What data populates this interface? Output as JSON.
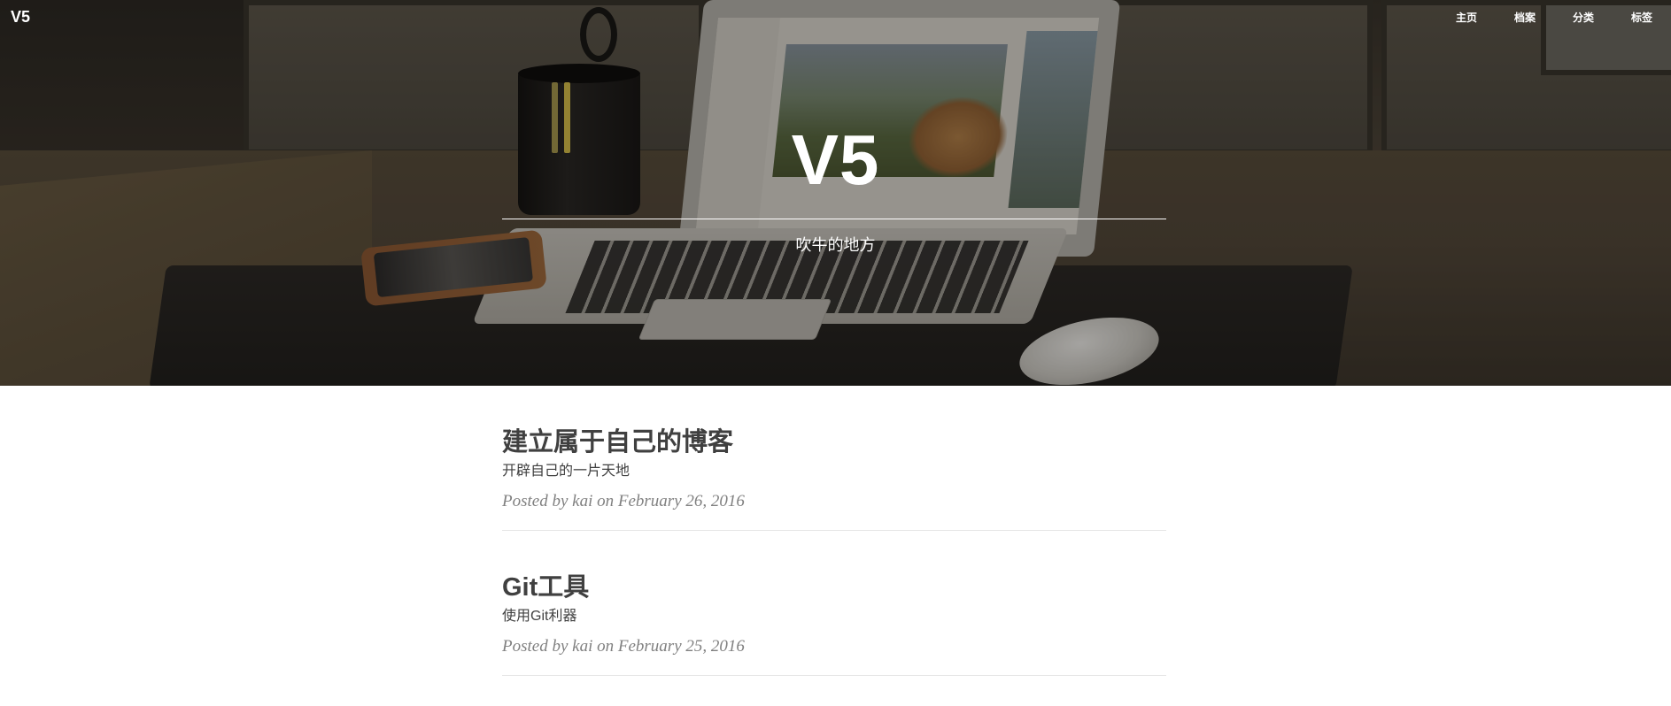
{
  "nav": {
    "brand": "V5",
    "links": [
      "主页",
      "档案",
      "分类",
      "标签"
    ]
  },
  "hero": {
    "title": "V5",
    "subtitle": "吹牛的地方"
  },
  "posts": [
    {
      "title": "建立属于自己的博客",
      "subtitle": "开辟自己的一片天地",
      "meta_prefix": "Posted by",
      "author": "kai",
      "meta_date": "on February 26, 2016"
    },
    {
      "title": "Git工具",
      "subtitle": "使用Git利器",
      "meta_prefix": "Posted by",
      "author": "kai",
      "meta_date": "on February 25, 2016"
    }
  ],
  "colors": {
    "text": "#404040",
    "meta": "#808080",
    "divider": "#e6e6e6",
    "hero_text": "#ffffff"
  }
}
